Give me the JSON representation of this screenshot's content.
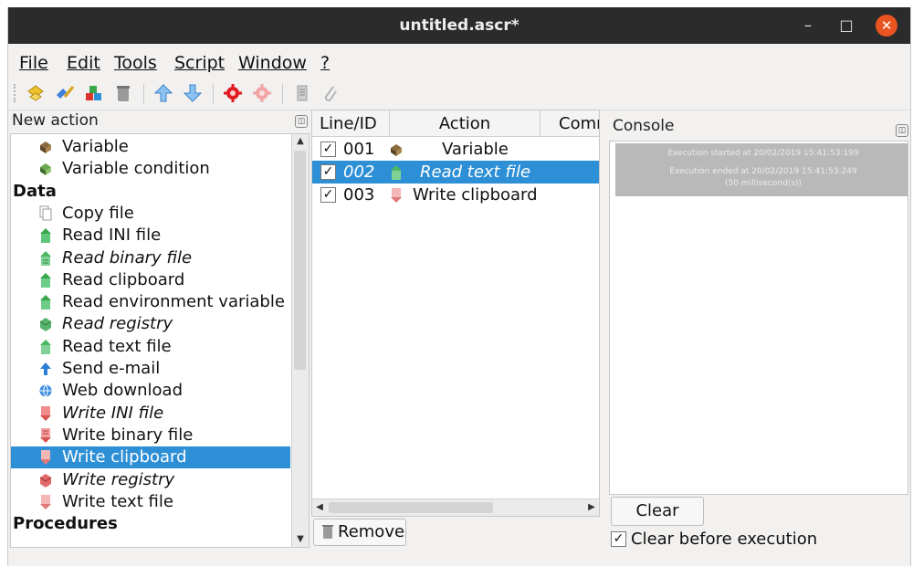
{
  "window": {
    "title": "untitled.ascr*",
    "min_glyph": "–",
    "max_glyph": "□",
    "close_glyph": "✕"
  },
  "menu": [
    {
      "label": "File"
    },
    {
      "label": "Edit"
    },
    {
      "label": "Tools"
    },
    {
      "label": "Script"
    },
    {
      "label": "Window"
    },
    {
      "label": "?"
    }
  ],
  "toolbar": {
    "icons": [
      "new-icon",
      "open-icon",
      "save-icon",
      "delete-icon",
      "move-up-icon",
      "move-down-icon",
      "execute-icon",
      "stop-icon",
      "script-icon",
      "attach-icon"
    ]
  },
  "left_panel": {
    "title": "New action",
    "items": [
      {
        "label": "Variable",
        "type": "item",
        "icon": "variable-icon"
      },
      {
        "label": "Variable condition",
        "type": "item",
        "icon": "variable-condition-icon"
      },
      {
        "label": "Data",
        "type": "category"
      },
      {
        "label": "Copy file",
        "type": "item",
        "icon": "copy-file-icon"
      },
      {
        "label": "Read INI file",
        "type": "item",
        "icon": "read-ini-icon"
      },
      {
        "label": "Read binary file",
        "type": "item",
        "italic": true,
        "icon": "read-binary-icon"
      },
      {
        "label": "Read clipboard",
        "type": "item",
        "icon": "read-clipboard-icon"
      },
      {
        "label": "Read environment variable",
        "type": "item",
        "icon": "read-env-icon"
      },
      {
        "label": "Read registry",
        "type": "item",
        "italic": true,
        "icon": "read-registry-icon"
      },
      {
        "label": "Read text file",
        "type": "item",
        "icon": "read-text-icon"
      },
      {
        "label": "Send e-mail",
        "type": "item",
        "icon": "send-email-icon"
      },
      {
        "label": "Web download",
        "type": "item",
        "icon": "web-download-icon"
      },
      {
        "label": "Write INI file",
        "type": "item",
        "italic": true,
        "icon": "write-ini-icon"
      },
      {
        "label": "Write binary file",
        "type": "item",
        "icon": "write-binary-icon"
      },
      {
        "label": "Write clipboard",
        "type": "item",
        "selected": true,
        "icon": "write-clipboard-icon"
      },
      {
        "label": "Write registry",
        "type": "item",
        "italic": true,
        "icon": "write-registry-icon"
      },
      {
        "label": "Write text file",
        "type": "item",
        "icon": "write-text-icon"
      },
      {
        "label": "Procedures",
        "type": "category"
      }
    ]
  },
  "script_table": {
    "columns": [
      "Line/ID",
      "Action",
      "Comm"
    ],
    "rows": [
      {
        "id": "001",
        "action": "Variable",
        "checked": true,
        "selected": false,
        "italic": false,
        "icon": "variable-icon"
      },
      {
        "id": "002",
        "action": "Read text file",
        "checked": true,
        "selected": true,
        "italic": true,
        "icon": "read-text-icon"
      },
      {
        "id": "003",
        "action": "Write clipboard",
        "checked": true,
        "selected": false,
        "italic": false,
        "icon": "write-clipboard-icon"
      }
    ],
    "remove_label": "Remove"
  },
  "console": {
    "title": "Console",
    "lines": [
      "Execution started at 20/02/2019 15:41:53:199",
      "Execution ended at 20/02/2019 15:41:53:249",
      "(50 millisecond(s))"
    ],
    "clear_label": "Clear",
    "clear_before_label": "Clear before execution",
    "clear_before_checked": true
  },
  "colors": {
    "selection": "#2d8fd5",
    "titlebar": "#2b2b2b",
    "close": "#e95420"
  }
}
